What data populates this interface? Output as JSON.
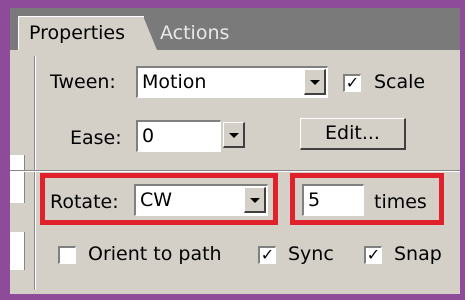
{
  "tabs": {
    "properties": "Properties",
    "actions": "Actions"
  },
  "tween": {
    "label": "Tween:",
    "value": "Motion",
    "scale_checked": "✓",
    "scale_label": "Scale"
  },
  "ease": {
    "label": "Ease:",
    "value": "0",
    "edit_button": "Edit..."
  },
  "rotate": {
    "label": "Rotate:",
    "value": "CW",
    "times_value": "5",
    "times_label": "times"
  },
  "options": {
    "orient_label": "Orient to path",
    "orient_checked": "",
    "sync_label": "Sync",
    "sync_checked": "✓",
    "snap_label": "Snap",
    "snap_checked": "✓"
  },
  "colors": {
    "frame_border": "#8e4b9a",
    "highlight": "#e0202a",
    "panel": "#d4d0c8"
  }
}
